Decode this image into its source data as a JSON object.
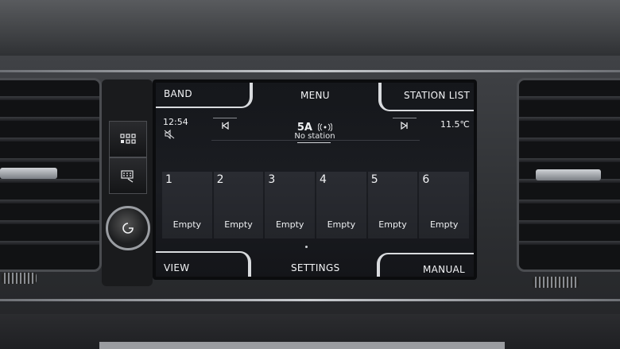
{
  "softkeys": {
    "band": "BAND",
    "menu": "MENU",
    "station_list": "STATION LIST",
    "view": "VIEW",
    "settings": "SETTINGS",
    "manual": "MANUAL"
  },
  "status": {
    "time": "12:54",
    "temperature": "11.5℃",
    "muted_icon": "speaker-off-icon"
  },
  "station": {
    "channel": "5A",
    "name": "No station",
    "signal_icon": "broadcast-icon"
  },
  "presets": [
    {
      "number": "1",
      "label": "Empty"
    },
    {
      "number": "2",
      "label": "Empty"
    },
    {
      "number": "3",
      "label": "Empty"
    },
    {
      "number": "4",
      "label": "Empty"
    },
    {
      "number": "5",
      "label": "Empty"
    },
    {
      "number": "6",
      "label": "Empty"
    }
  ],
  "colors": {
    "screen_bg": "#1b1d22",
    "preset_bg": "#2a2c32",
    "text": "#eef0f2"
  }
}
